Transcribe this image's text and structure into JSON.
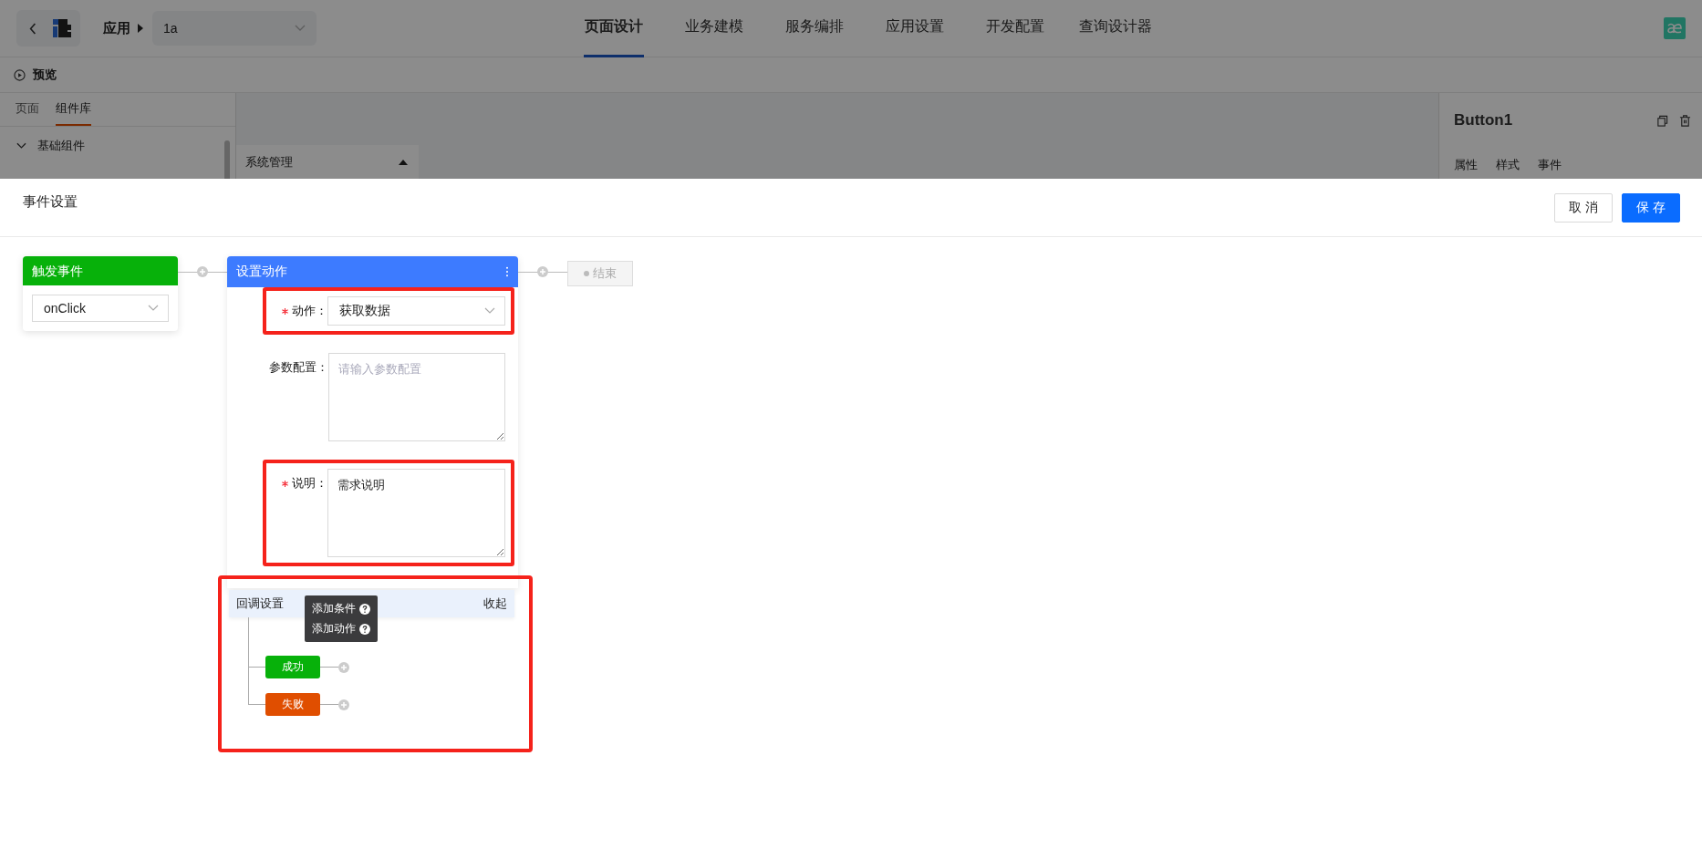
{
  "header": {
    "app_label": "应用",
    "app_select": "1a",
    "tabs": [
      {
        "label": "页面设计",
        "selected": true
      },
      {
        "label": "业务建模",
        "selected": false
      },
      {
        "label": "服务编排",
        "selected": false
      },
      {
        "label": "应用设置",
        "selected": false
      },
      {
        "label": "开发配置",
        "selected": false
      },
      {
        "label": "查询设计器",
        "selected": false
      }
    ]
  },
  "toolbar": {
    "preview": "预览"
  },
  "left_panel": {
    "tabs": [
      {
        "label": "页面",
        "selected": false
      },
      {
        "label": "组件库",
        "selected": true
      }
    ],
    "group": {
      "label": "基础组件",
      "expanded": true
    }
  },
  "canvas": {
    "menu_item": "系统管理"
  },
  "right_panel": {
    "title": "Button1",
    "tabs": [
      "属性",
      "样式",
      "事件"
    ]
  },
  "dialog": {
    "title": "事件设置",
    "buttons": [
      {
        "label": "取 消",
        "kind": "default"
      },
      {
        "label": "保 存",
        "kind": "primary"
      }
    ],
    "trigger": {
      "title": "触发事件",
      "value": "onClick"
    },
    "action": {
      "title": "设置动作",
      "fields": [
        {
          "label": "动作：",
          "required": true,
          "kind": "select",
          "value": "获取数据",
          "highlighted": true
        },
        {
          "label": "参数配置：",
          "required": false,
          "kind": "textarea",
          "placeholder": "请输入参数配置",
          "highlighted": false
        },
        {
          "label": "说明：",
          "required": true,
          "kind": "textarea",
          "value": "需求说明",
          "highlighted": true
        }
      ]
    },
    "end": {
      "label": "结束"
    },
    "callback": {
      "title": "回调设置",
      "toggle": "收起",
      "highlighted": true,
      "tooltip": [
        "添加条件",
        "添加动作"
      ],
      "branches": [
        {
          "label": "成功",
          "color": "#07b10a"
        },
        {
          "label": "失败",
          "color": "#e04e00"
        }
      ]
    }
  }
}
